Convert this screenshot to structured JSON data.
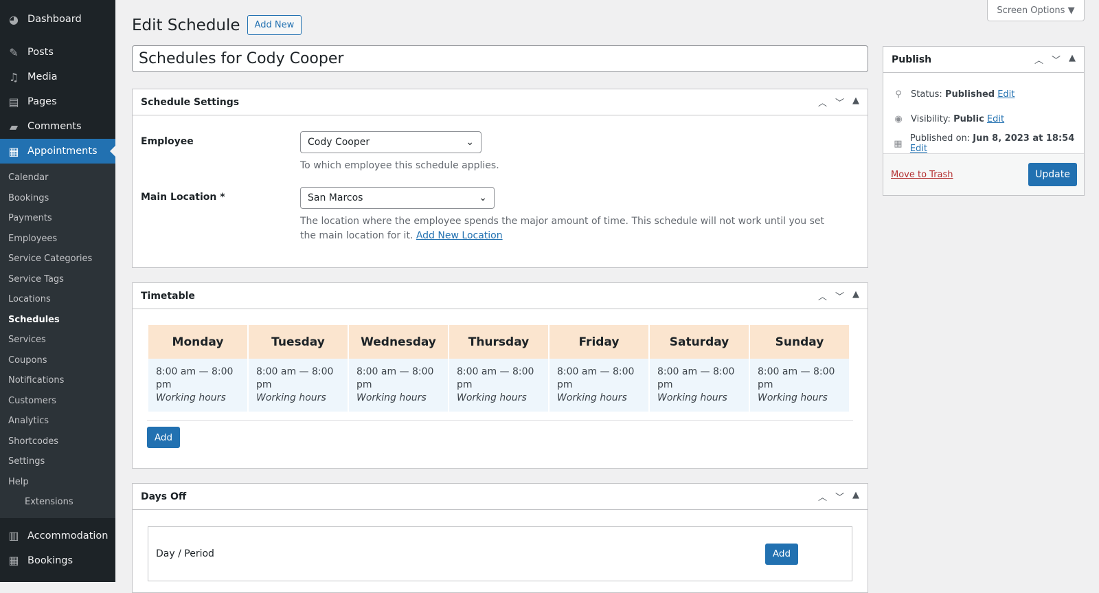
{
  "sidebar": {
    "top": [
      {
        "label": "Dashboard",
        "icon": "dashboard-icon"
      }
    ],
    "items": [
      {
        "label": "Posts",
        "icon": "pin-icon"
      },
      {
        "label": "Media",
        "icon": "media-icon"
      },
      {
        "label": "Pages",
        "icon": "pages-icon"
      },
      {
        "label": "Comments",
        "icon": "comment-icon"
      },
      {
        "label": "Appointments",
        "icon": "calendar-icon"
      }
    ],
    "submenu": [
      "Calendar",
      "Bookings",
      "Payments",
      "Employees",
      "Service Categories",
      "Service Tags",
      "Locations",
      "Schedules",
      "Services",
      "Coupons",
      "Notifications",
      "Customers",
      "Analytics",
      "Shortcodes",
      "Settings",
      "Help",
      "Extensions"
    ],
    "bottom": [
      {
        "label": "Accommodation",
        "icon": "building-icon"
      },
      {
        "label": "Bookings",
        "icon": "calendar-icon"
      }
    ]
  },
  "screen_options": "Screen Options",
  "header": {
    "title": "Edit Schedule",
    "add_new": "Add New"
  },
  "post_title": "Schedules for Cody Cooper",
  "settings": {
    "title": "Schedule Settings",
    "employee_label": "Employee",
    "employee_value": "Cody Cooper",
    "employee_desc": "To which employee this schedule applies.",
    "location_label": "Main Location *",
    "location_value": "San Marcos",
    "location_desc": "The location where the employee spends the major amount of time. This schedule will not work until you set the main location for it.",
    "location_link": "Add New Location"
  },
  "timetable": {
    "title": "Timetable",
    "days": [
      {
        "day": "Monday",
        "time": "8:00 am — 8:00 pm",
        "type": "Working hours"
      },
      {
        "day": "Tuesday",
        "time": "8:00 am — 8:00 pm",
        "type": "Working hours"
      },
      {
        "day": "Wednesday",
        "time": "8:00 am — 8:00 pm",
        "type": "Working hours"
      },
      {
        "day": "Thursday",
        "time": "8:00 am — 8:00 pm",
        "type": "Working hours"
      },
      {
        "day": "Friday",
        "time": "8:00 am — 8:00 pm",
        "type": "Working hours"
      },
      {
        "day": "Saturday",
        "time": "8:00 am — 8:00 pm",
        "type": "Working hours"
      },
      {
        "day": "Sunday",
        "time": "8:00 am — 8:00 pm",
        "type": "Working hours"
      }
    ],
    "add": "Add"
  },
  "days_off": {
    "title": "Days Off",
    "column": "Day / Period",
    "add": "Add"
  },
  "publish": {
    "title": "Publish",
    "status_label": "Status:",
    "status": "Published",
    "visibility_label": "Visibility:",
    "visibility": "Public",
    "published_label": "Published on:",
    "published": "Jun 8, 2023 at 18:54",
    "edit": "Edit",
    "trash": "Move to Trash",
    "update": "Update"
  }
}
